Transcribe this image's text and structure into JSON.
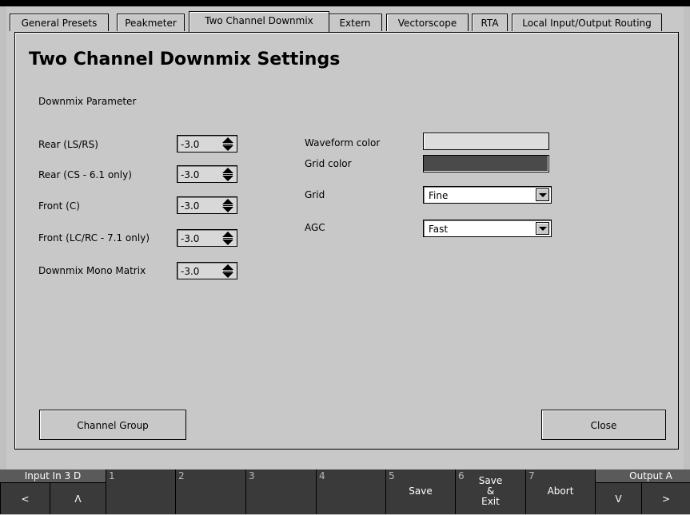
{
  "tabs": [
    {
      "label": "General Presets"
    },
    {
      "label": "Peakmeter"
    },
    {
      "label": "Two Channel Downmix"
    },
    {
      "label": "Extern"
    },
    {
      "label": "Vectorscope"
    },
    {
      "label": "RTA"
    },
    {
      "label": "Local Input/Output Routing"
    }
  ],
  "active_tab": "Two Channel Downmix",
  "title": "Two Channel Downmix Settings",
  "section_label": "Downmix Parameter",
  "params": [
    {
      "label": "Rear (LS/RS)",
      "value": "-3.0"
    },
    {
      "label": "Rear (CS - 6.1 only)",
      "value": "-3.0"
    },
    {
      "label": "Front (C)",
      "value": "-3.0"
    },
    {
      "label": "Front (LC/RC - 7.1 only)",
      "value": "-3.0"
    },
    {
      "label": "Downmix Mono Matrix",
      "value": "-3.0"
    }
  ],
  "right": {
    "waveform_label": "Waveform color",
    "waveform_color": "#dcdcdc",
    "grid_color_label": "Grid color",
    "grid_color": "#4a4a4a",
    "grid_label": "Grid",
    "grid_value": "Fine",
    "agc_label": "AGC",
    "agc_value": "Fast"
  },
  "buttons": {
    "channel_group": "Channel Group",
    "close": "Close"
  },
  "softkeys": {
    "input": "Input In 3 D",
    "input_left": "<",
    "input_up": "Λ",
    "k1": "1",
    "k2": "2",
    "k3": "3",
    "k4": "4",
    "k5": "5",
    "save": "Save",
    "k6": "6",
    "save_exit": [
      "Save",
      "&",
      "Exit"
    ],
    "k7": "7",
    "abort": "Abort",
    "output": "Output A",
    "output_down": "V",
    "output_right": ">"
  }
}
